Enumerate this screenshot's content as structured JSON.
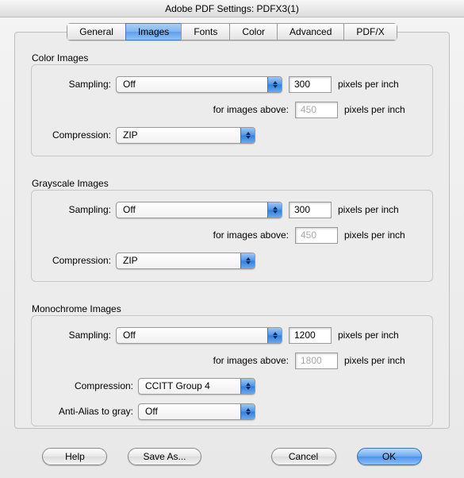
{
  "window": {
    "title": "Adobe PDF Settings: PDFX3(1)"
  },
  "tabs": {
    "general": "General",
    "images": "Images",
    "fonts": "Fonts",
    "color": "Color",
    "advanced": "Advanced",
    "pdfx": "PDF/X"
  },
  "labels": {
    "sampling": "Sampling:",
    "compression": "Compression:",
    "antialias": "Anti-Alias to gray:",
    "for_images_above": "for images above:",
    "ppi": "pixels per inch"
  },
  "color_images": {
    "title": "Color Images",
    "sampling": "Off",
    "res": "300",
    "above": "450",
    "compression": "ZIP"
  },
  "gray_images": {
    "title": "Grayscale Images",
    "sampling": "Off",
    "res": "300",
    "above": "450",
    "compression": "ZIP"
  },
  "mono_images": {
    "title": "Monochrome Images",
    "sampling": "Off",
    "res": "1200",
    "above": "1800",
    "compression": "CCITT Group 4",
    "antialias": "Off"
  },
  "buttons": {
    "help": "Help",
    "saveas": "Save As...",
    "cancel": "Cancel",
    "ok": "OK"
  }
}
